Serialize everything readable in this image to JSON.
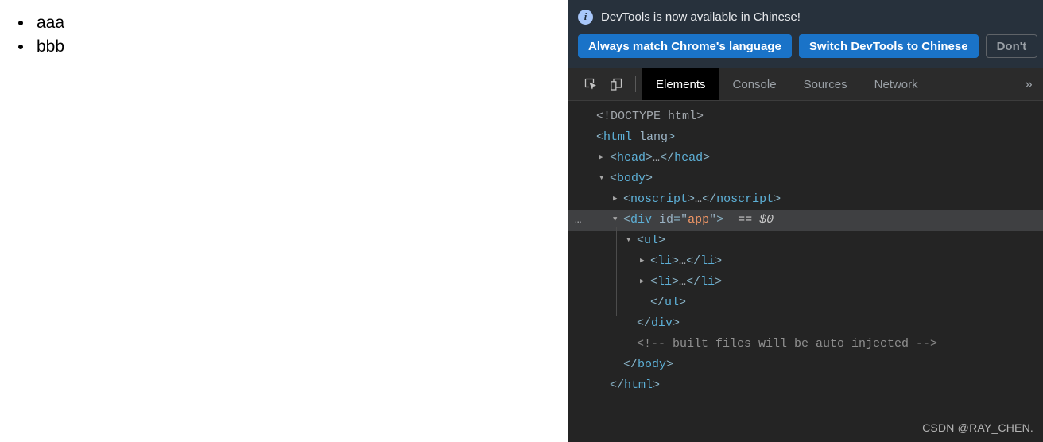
{
  "page": {
    "list_items": [
      "aaa",
      "bbb"
    ]
  },
  "devtools": {
    "infobar": {
      "icon": "info-icon",
      "message": "DevTools is now available in Chinese!",
      "buttons": [
        {
          "label": "Always match Chrome's language",
          "style": "primary"
        },
        {
          "label": "Switch DevTools to Chinese",
          "style": "primary"
        },
        {
          "label": "Don't",
          "style": "secondary"
        }
      ]
    },
    "toolbar": {
      "icons": [
        {
          "name": "inspect-element-icon"
        },
        {
          "name": "device-toolbar-icon"
        }
      ],
      "tabs": [
        {
          "label": "Elements",
          "active": true
        },
        {
          "label": "Console",
          "active": false
        },
        {
          "label": "Sources",
          "active": false
        },
        {
          "label": "Network",
          "active": false
        }
      ],
      "overflow_label": "»"
    },
    "dom_tree": {
      "rows": [
        {
          "indent": 0,
          "twisty": "none",
          "selected": false,
          "badge": "",
          "parts": [
            {
              "t": "<!DOCTYPE html>",
              "c": "c-doctype"
            }
          ]
        },
        {
          "indent": 0,
          "twisty": "none",
          "selected": false,
          "badge": "",
          "parts": [
            {
              "t": "<",
              "c": "c-punct"
            },
            {
              "t": "html",
              "c": "c-tag"
            },
            {
              "t": " ",
              "c": "c-punct"
            },
            {
              "t": "lang",
              "c": "c-attr"
            },
            {
              "t": ">",
              "c": "c-punct"
            }
          ]
        },
        {
          "indent": 1,
          "twisty": "collapsed",
          "selected": false,
          "badge": "",
          "parts": [
            {
              "t": "<",
              "c": "c-punct"
            },
            {
              "t": "head",
              "c": "c-tag"
            },
            {
              "t": ">",
              "c": "c-punct"
            },
            {
              "t": "…",
              "c": "c-text"
            },
            {
              "t": "</",
              "c": "c-punct"
            },
            {
              "t": "head",
              "c": "c-tag"
            },
            {
              "t": ">",
              "c": "c-punct"
            }
          ]
        },
        {
          "indent": 1,
          "twisty": "expanded",
          "selected": false,
          "badge": "",
          "parts": [
            {
              "t": "<",
              "c": "c-punct"
            },
            {
              "t": "body",
              "c": "c-tag"
            },
            {
              "t": ">",
              "c": "c-punct"
            }
          ]
        },
        {
          "indent": 2,
          "twisty": "collapsed",
          "selected": false,
          "badge": "",
          "parts": [
            {
              "t": "<",
              "c": "c-punct"
            },
            {
              "t": "noscript",
              "c": "c-tag"
            },
            {
              "t": ">",
              "c": "c-punct"
            },
            {
              "t": "…",
              "c": "c-text"
            },
            {
              "t": "</",
              "c": "c-punct"
            },
            {
              "t": "noscript",
              "c": "c-tag"
            },
            {
              "t": ">",
              "c": "c-punct"
            }
          ]
        },
        {
          "indent": 2,
          "twisty": "expanded",
          "selected": true,
          "badge": "…",
          "parts": [
            {
              "t": "<",
              "c": "c-punct"
            },
            {
              "t": "div",
              "c": "c-tag"
            },
            {
              "t": " ",
              "c": "c-punct"
            },
            {
              "t": "id",
              "c": "c-attr"
            },
            {
              "t": "=",
              "c": "c-punct"
            },
            {
              "t": "\"",
              "c": "c-quote"
            },
            {
              "t": "app",
              "c": "c-value"
            },
            {
              "t": "\"",
              "c": "c-quote"
            },
            {
              "t": ">",
              "c": "c-punct"
            },
            {
              "t": "  ",
              "c": "c-punct"
            },
            {
              "t": "== $0",
              "c": "c-dollar"
            }
          ]
        },
        {
          "indent": 3,
          "twisty": "expanded",
          "selected": false,
          "badge": "",
          "parts": [
            {
              "t": "<",
              "c": "c-punct"
            },
            {
              "t": "ul",
              "c": "c-tag"
            },
            {
              "t": ">",
              "c": "c-punct"
            }
          ]
        },
        {
          "indent": 4,
          "twisty": "collapsed",
          "selected": false,
          "badge": "",
          "parts": [
            {
              "t": "<",
              "c": "c-punct"
            },
            {
              "t": "li",
              "c": "c-tag"
            },
            {
              "t": ">",
              "c": "c-punct"
            },
            {
              "t": "…",
              "c": "c-text"
            },
            {
              "t": "</",
              "c": "c-punct"
            },
            {
              "t": "li",
              "c": "c-tag"
            },
            {
              "t": ">",
              "c": "c-punct"
            }
          ]
        },
        {
          "indent": 4,
          "twisty": "collapsed",
          "selected": false,
          "badge": "",
          "parts": [
            {
              "t": "<",
              "c": "c-punct"
            },
            {
              "t": "li",
              "c": "c-tag"
            },
            {
              "t": ">",
              "c": "c-punct"
            },
            {
              "t": "…",
              "c": "c-text"
            },
            {
              "t": "</",
              "c": "c-punct"
            },
            {
              "t": "li",
              "c": "c-tag"
            },
            {
              "t": ">",
              "c": "c-punct"
            }
          ]
        },
        {
          "indent": 4,
          "twisty": "none",
          "selected": false,
          "badge": "",
          "parts": [
            {
              "t": "</",
              "c": "c-punct"
            },
            {
              "t": "ul",
              "c": "c-tag"
            },
            {
              "t": ">",
              "c": "c-punct"
            }
          ]
        },
        {
          "indent": 3,
          "twisty": "none",
          "selected": false,
          "badge": "",
          "parts": [
            {
              "t": "</",
              "c": "c-punct"
            },
            {
              "t": "div",
              "c": "c-tag"
            },
            {
              "t": ">",
              "c": "c-punct"
            }
          ]
        },
        {
          "indent": 3,
          "twisty": "none",
          "selected": false,
          "badge": "",
          "parts": [
            {
              "t": "<!-- built files will be auto injected -->",
              "c": "c-comment"
            }
          ]
        },
        {
          "indent": 2,
          "twisty": "none",
          "selected": false,
          "badge": "",
          "parts": [
            {
              "t": "</",
              "c": "c-punct"
            },
            {
              "t": "body",
              "c": "c-tag"
            },
            {
              "t": ">",
              "c": "c-punct"
            }
          ]
        },
        {
          "indent": 1,
          "twisty": "none",
          "selected": false,
          "badge": "",
          "parts": [
            {
              "t": "</",
              "c": "c-punct"
            },
            {
              "t": "html",
              "c": "c-tag"
            },
            {
              "t": ">",
              "c": "c-punct"
            }
          ]
        }
      ]
    },
    "watermark": "CSDN @RAY_CHEN."
  },
  "colors": {
    "devtools_bg": "#242424",
    "infobar_bg": "#27313c",
    "tabstrip_bg": "#2b2b2b",
    "accent_blue": "#1a73c8",
    "selected_row": "#3f4042",
    "tag_blue": "#5db0d7",
    "attr_value_orange": "#f29766"
  }
}
